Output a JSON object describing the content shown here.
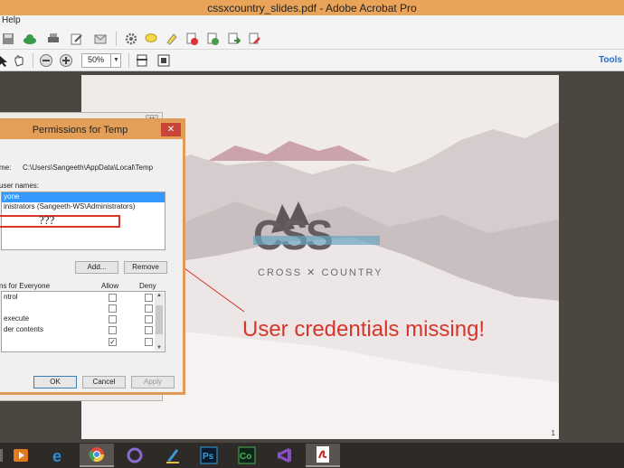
{
  "window": {
    "title": "cssxcountry_slides.pdf - Adobe Acrobat Pro"
  },
  "menubar": {
    "items": [
      "Help"
    ]
  },
  "toolbar": {
    "zoom_value": "50%",
    "tools_label": "Tools",
    "icons": [
      "save-icon",
      "cloud-upload-icon",
      "print-icon",
      "edit-icon",
      "email-icon",
      "gear-icon",
      "comment-icon",
      "highlight-icon",
      "pdf-remove-icon",
      "pdf-check-icon",
      "pdf-export-icon",
      "pdf-sign-icon"
    ]
  },
  "page": {
    "logo_text": "CROSS ✕ COUNTRY",
    "annotation": "User credentials missing!",
    "page_number": "1"
  },
  "dialog": {
    "title": "Permissions for Temp",
    "object_name_label": "me:",
    "object_name_value": "C:\\Users\\Sangeeth\\AppData\\Local\\Temp",
    "group_label": "user names:",
    "users": [
      "yone",
      "inistrators (Sangeeth-WS\\Administrators)"
    ],
    "missing_marker": "???",
    "add_label": "Add...",
    "remove_label": "Remove",
    "perm_label": "ns for Everyone",
    "allow_header": "Allow",
    "deny_header": "Deny",
    "permissions": [
      {
        "name": "ntrol",
        "allow": false,
        "deny": false
      },
      {
        "name": "",
        "allow": false,
        "deny": false
      },
      {
        "name": "execute",
        "allow": false,
        "deny": false
      },
      {
        "name": "der contents",
        "allow": false,
        "deny": false
      },
      {
        "name": "",
        "allow": true,
        "deny": false
      }
    ],
    "ok_label": "OK",
    "cancel_label": "Cancel",
    "apply_label": "Apply"
  },
  "taskbar": {
    "apps": [
      "media-player-icon",
      "internet-explorer-icon",
      "chrome-icon",
      "torrent-icon",
      "pen-app-icon",
      "photoshop-icon",
      "captivate-icon",
      "visual-studio-icon",
      "acrobat-icon"
    ],
    "ps_text": "Ps",
    "co_text": "Co"
  },
  "colors": {
    "annotation": "#d8352a",
    "accent_window": "#e9a45a",
    "selection": "#3399ff"
  }
}
